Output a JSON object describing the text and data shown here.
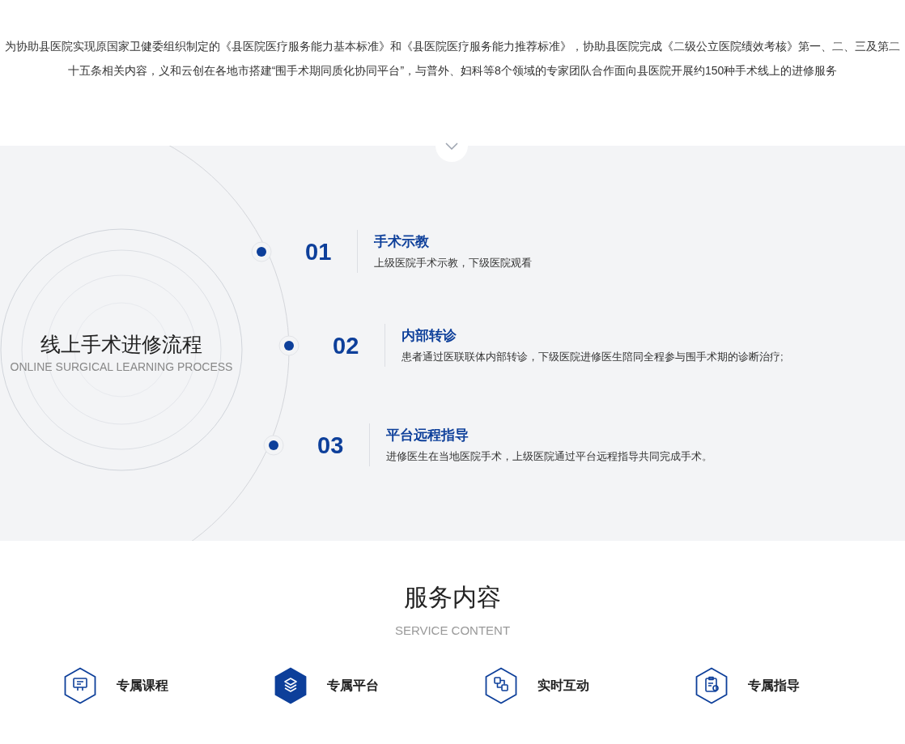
{
  "intro": {
    "text": "为协助县医院实现原国家卫健委组织制定的《县医院医疗服务能力基本标准》和《县医院医疗服务能力推荐标准》，协助县医院完成《二级公立医院绩效考核》第一、二、三及第二十五条相关内容，义和云创在各地市搭建“围手术期同质化协同平台”，与普外、妇科等8个领域的专家团队合作面向县医院开展约150种手术线上的进修服务"
  },
  "process": {
    "title": "线上手术进修流程",
    "subtitle": "ONLINE SURGICAL LEARNING PROCESS",
    "steps": [
      {
        "number": "01",
        "title": "手术示教",
        "description": "上级医院手术示教，下级医院观看"
      },
      {
        "number": "02",
        "title": "内部转诊",
        "description": "患者通过医联联体内部转诊，下级医院进修医生陪同全程参与围手术期的诊断治疗;"
      },
      {
        "number": "03",
        "title": "平台远程指导",
        "description": "进修医生在当地医院手术，上级医院通过平台远程指导共同完成手术。"
      }
    ]
  },
  "services": {
    "title": "服务内容",
    "subtitle": "SERVICE CONTENT",
    "items": [
      {
        "label": "专属课程",
        "selected": false
      },
      {
        "label": "专属平台",
        "selected": true
      },
      {
        "label": "实时互动",
        "selected": false
      },
      {
        "label": "专属指导",
        "selected": false
      }
    ]
  }
}
